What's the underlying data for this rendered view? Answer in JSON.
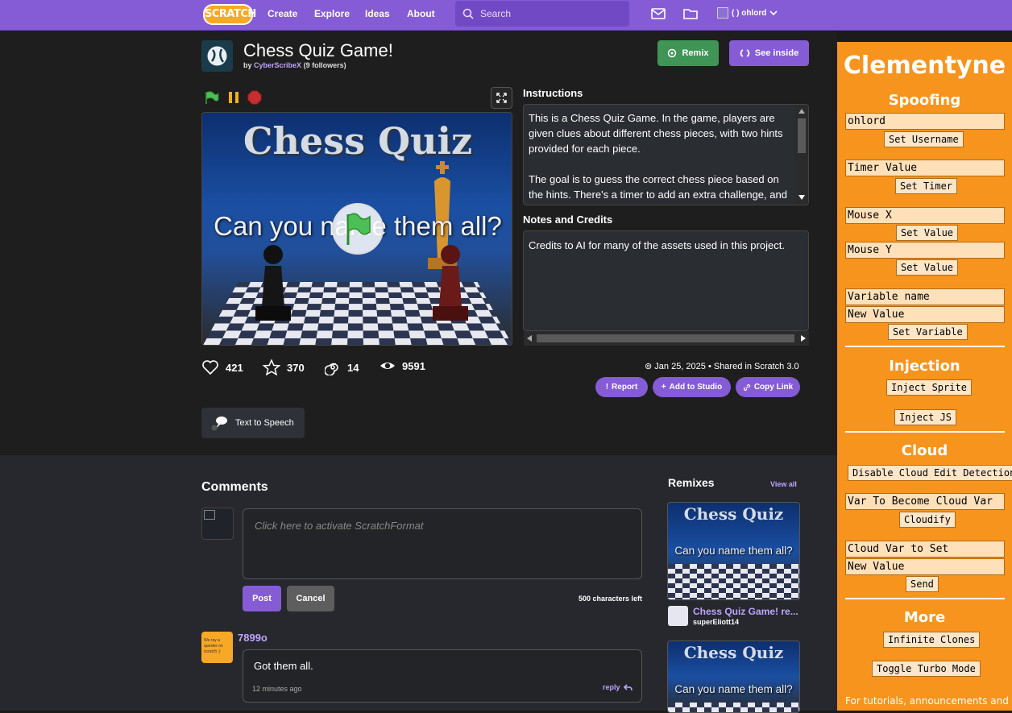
{
  "navbar": {
    "logo": "SCRATCH",
    "links": [
      "Create",
      "Explore",
      "Ideas",
      "About"
    ],
    "search_placeholder": "Search",
    "user": "( ) ohlord"
  },
  "project": {
    "title": "Chess Quiz Game!",
    "by": "by",
    "author": "CyberScribeX",
    "followers": "(9 followers)",
    "remix_label": "Remix",
    "see_inside_label": "See inside",
    "stage_title": "Chess Quiz",
    "stage_subtitle": "Can you name them all?"
  },
  "instructions": {
    "title": "Instructions",
    "p1": "This is a Chess Quiz Game. In the game, players are given clues about different chess pieces, with two hints provided for each piece.",
    "p2": "The goal is to guess the correct chess piece based on the hints. There's a timer to add an extra challenge, and"
  },
  "notes": {
    "title": "Notes and Credits",
    "text": "Credits to AI for many of the assets used in this project."
  },
  "stats": {
    "loves": "421",
    "favorites": "370",
    "remixes": "14",
    "views": "9591"
  },
  "shared": "Jan 25, 2025 • Shared in Scratch 3.0",
  "actions": {
    "report": "Report",
    "add_studio": "Add to Studio",
    "copy_link": "Copy Link",
    "tts": "Text to Speech"
  },
  "comments": {
    "title": "Comments",
    "placeholder": "Click here to activate ScratchFormat",
    "post": "Post",
    "cancel": "Cancel",
    "chars_left": "500 characters left",
    "items": [
      {
        "user": "7899o",
        "avatar_text": "We ray a quester on scratch ;)",
        "text": "Got them all.",
        "time": "12 minutes ago",
        "reply": "reply"
      }
    ]
  },
  "remixes": {
    "title": "Remixes",
    "view_all": "View all",
    "items": [
      {
        "thumb_title": "Chess Quiz",
        "thumb_subtitle": "Can you name them all?",
        "name": "Chess Quiz Game! re...",
        "author": "superEliott14"
      },
      {
        "thumb_title": "Chess Quiz",
        "thumb_subtitle": "Can you name them all?"
      }
    ]
  },
  "clementyne": {
    "title": "Clementyne",
    "spoofing": "Spoofing",
    "username_value": "ohlord",
    "set_username": "Set Username",
    "timer_placeholder": "Timer Value",
    "set_timer": "Set Timer",
    "mouse_x": "Mouse X",
    "mouse_y": "Mouse Y",
    "set_value": "Set Value",
    "variable_name": "Variable name",
    "new_value": "New Value",
    "set_variable": "Set Variable",
    "injection": "Injection",
    "inject_sprite": "Inject Sprite",
    "inject_js": "Inject JS",
    "cloud": "Cloud",
    "disable_cloud": "Disable Cloud Edit Detection",
    "var_to_cloud": "Var To Become Cloud Var",
    "cloudify": "Cloudify",
    "cloud_var_to_set": "Cloud Var to Set",
    "cloud_new_value": "New Value",
    "send": "Send",
    "more": "More",
    "infinite_clones": "Infinite Clones",
    "toggle_turbo": "Toggle Turbo Mode",
    "footer": "For tutorials, announcements and"
  }
}
